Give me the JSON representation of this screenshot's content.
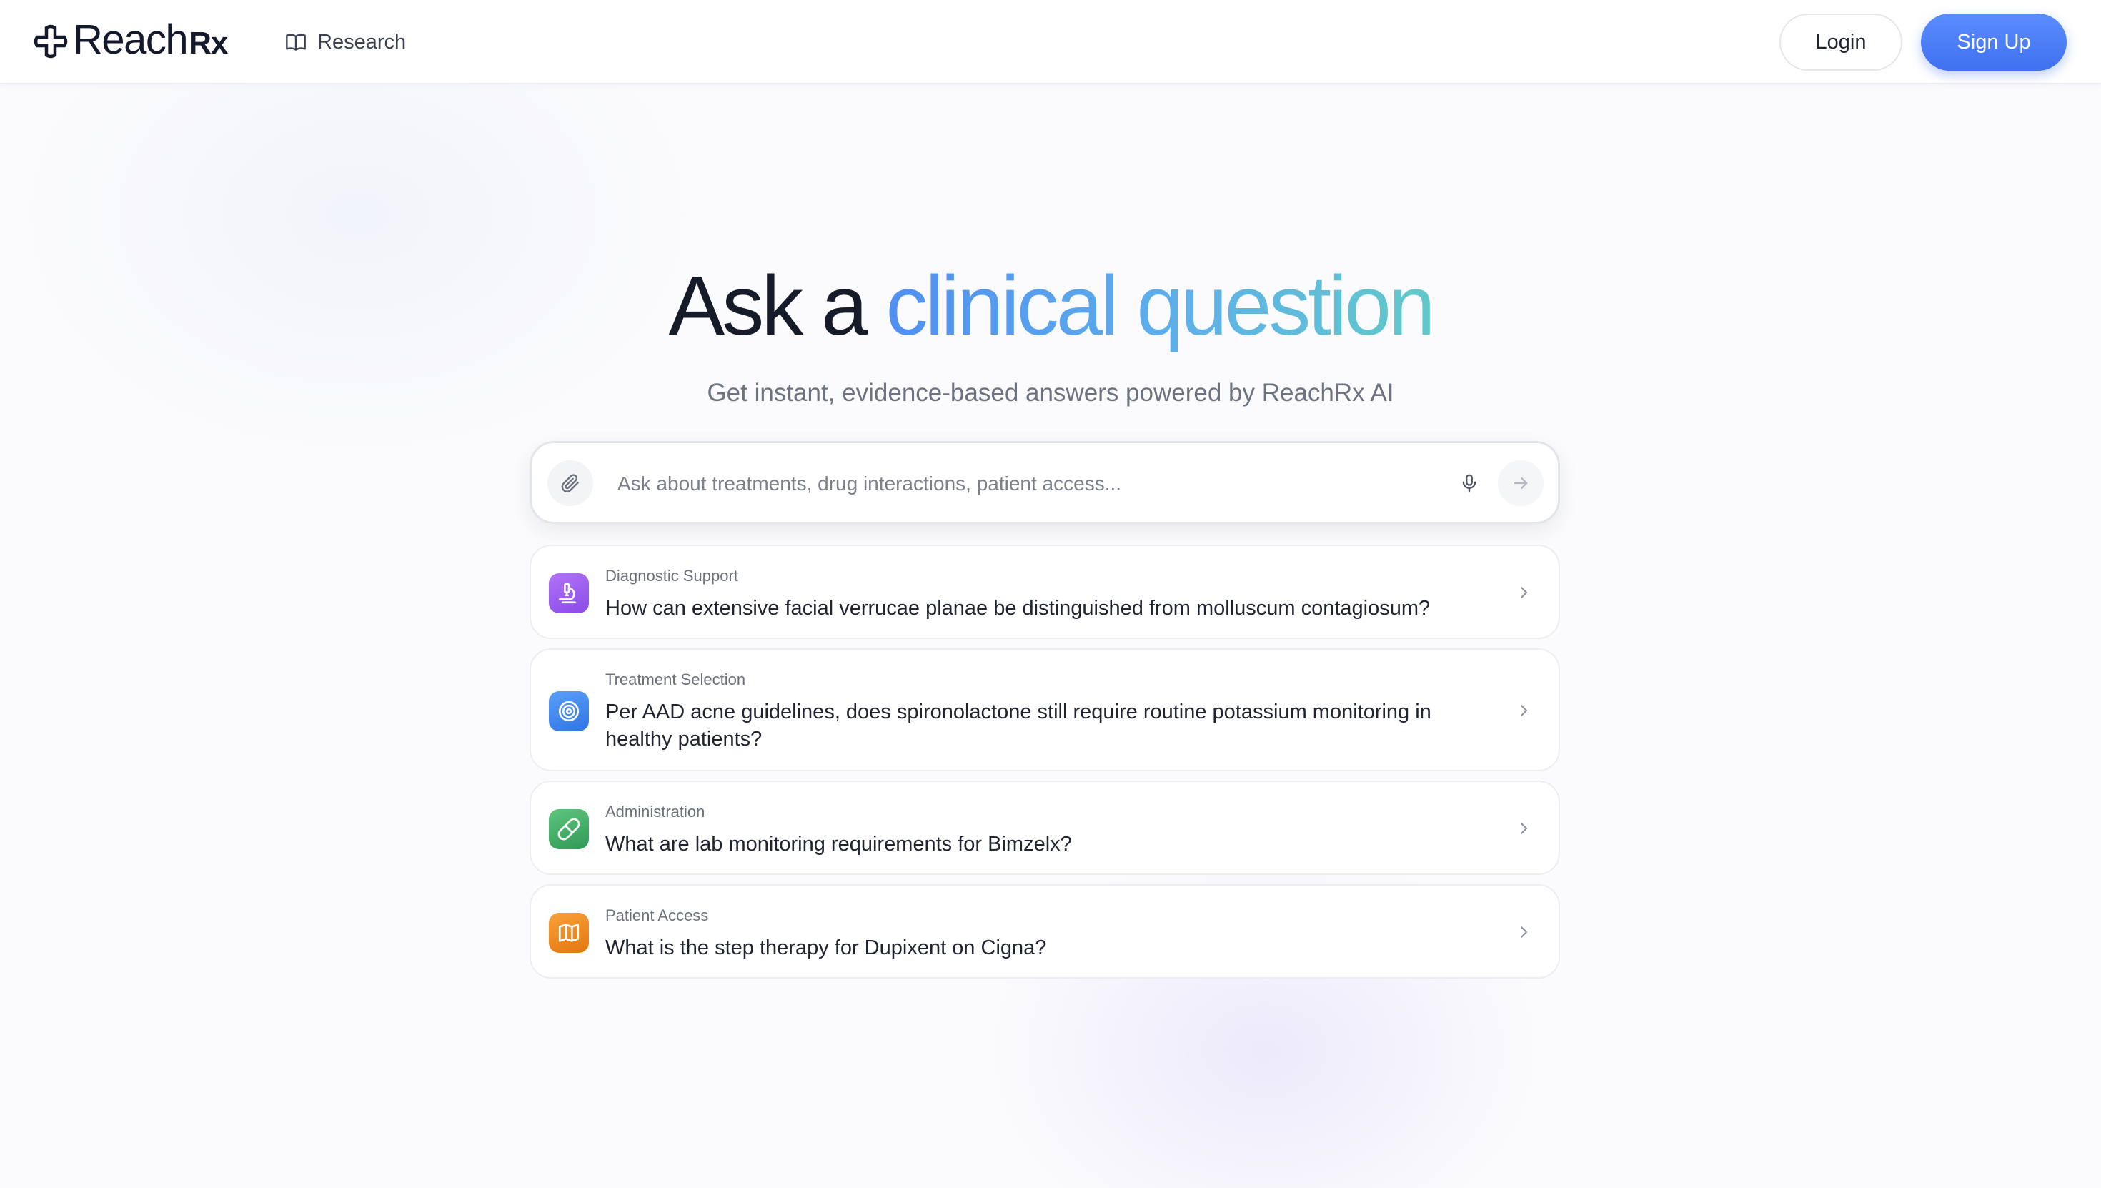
{
  "header": {
    "brand": {
      "word": "Reach",
      "suffix": "Rx"
    },
    "nav": {
      "research_label": "Research",
      "research_icon": "book-open-icon"
    },
    "login_label": "Login",
    "signup_label": "Sign Up"
  },
  "hero": {
    "title_plain": "Ask a ",
    "title_highlight": "clinical question",
    "subtitle": "Get instant, evidence-based answers powered by ReachRx AI"
  },
  "search": {
    "placeholder": "Ask about treatments, drug interactions, patient access...",
    "attach_icon": "paperclip-icon",
    "mic_icon": "microphone-icon",
    "send_icon": "arrow-right-icon"
  },
  "suggestions": [
    {
      "category": "Diagnostic Support",
      "question": "How can extensive facial verrucae planae be distinguished from molluscum contagiosum?",
      "icon": "microscope-icon",
      "color": "#9b5cf0"
    },
    {
      "category": "Treatment Selection",
      "question": "Per AAD acne guidelines, does spironolactone still require routine potassium monitoring in healthy patients?",
      "icon": "target-icon",
      "color": "#3e86ee"
    },
    {
      "category": "Administration",
      "question": "What are lab monitoring requirements for Bimzelx?",
      "icon": "pill-icon",
      "color": "#3fae6a"
    },
    {
      "category": "Patient Access",
      "question": "What is the step therapy for Dupixent on Cigna?",
      "icon": "map-icon",
      "color": "#f08a1c"
    }
  ],
  "colors": {
    "accent": "#4a7cf5",
    "title_gradient_start": "#4f8ff2",
    "title_gradient_end": "#60c9c8"
  }
}
